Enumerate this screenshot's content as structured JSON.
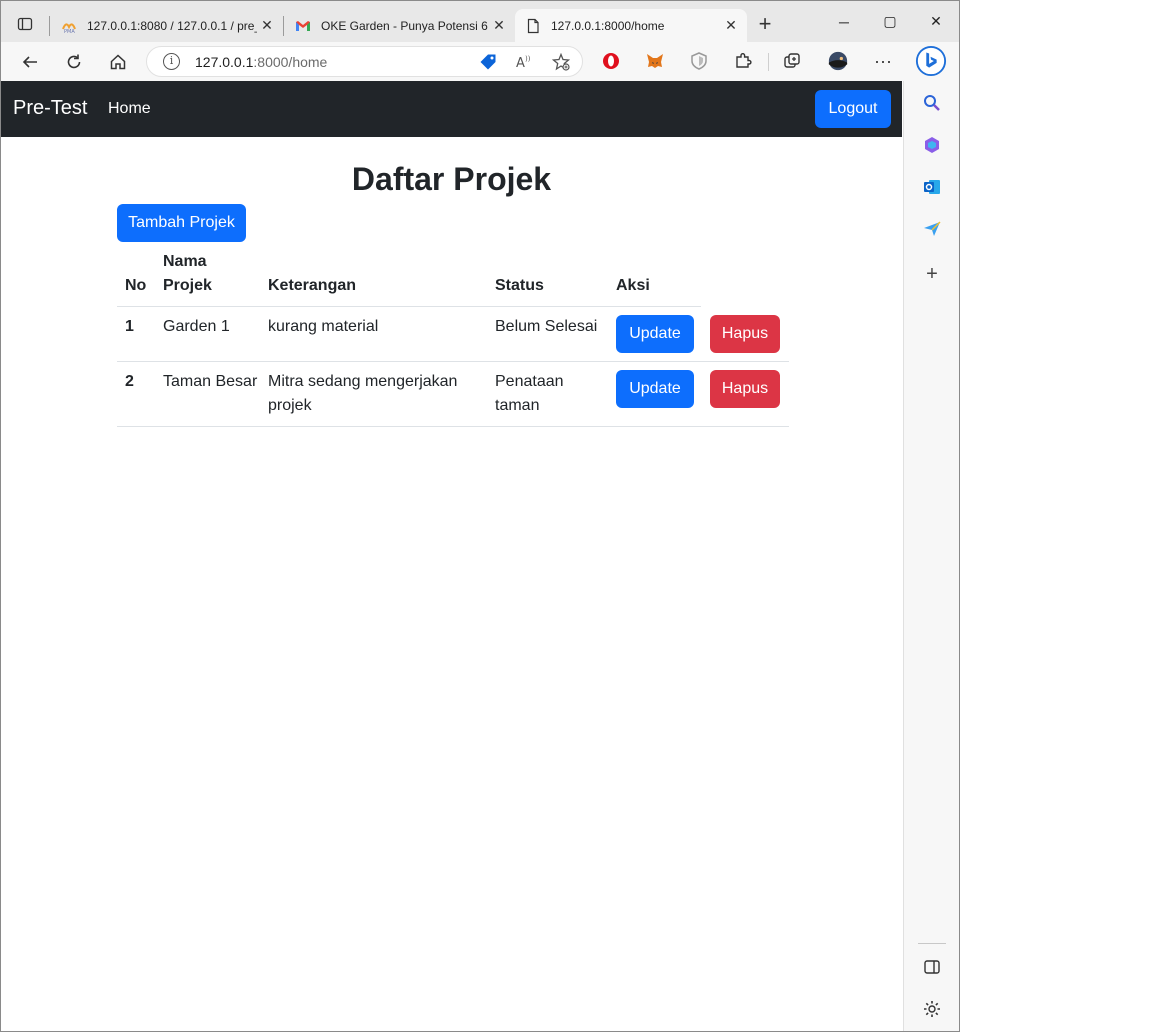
{
  "browser": {
    "tabs": [
      {
        "title": "127.0.0.1:8080 / 127.0.0.1 / pre_",
        "icon": "phpmyadmin-icon",
        "active": false
      },
      {
        "title": "OKE Garden - Punya Potensi 6 -",
        "icon": "gmail-icon",
        "active": false
      },
      {
        "title": "127.0.0.1:8000/home",
        "icon": "page-icon",
        "active": true
      }
    ],
    "new_tab_label": "+",
    "address": {
      "host": "127.0.0.1",
      "path": ":8000/home"
    },
    "window_controls": {
      "minimize": "─",
      "maximize": "▢",
      "close": "✕"
    }
  },
  "navbar": {
    "brand": "Pre-Test",
    "links": [
      "Home"
    ],
    "logout_label": "Logout",
    "bg_color": "#212529"
  },
  "page": {
    "title": "Daftar Projek",
    "add_button": "Tambah Projek",
    "table": {
      "headers": {
        "no": "No",
        "nama_line1": "Nama",
        "nama_line2": "Projek",
        "keterangan": "Keterangan",
        "status": "Status",
        "aksi": "Aksi"
      },
      "rows": [
        {
          "no": "1",
          "nama": "Garden 1",
          "keterangan": "kurang material",
          "keterangan2": "",
          "status": "Belum Selesai",
          "status2": "",
          "update": "Update",
          "hapus": "Hapus"
        },
        {
          "no": "2",
          "nama": "Taman Besar",
          "keterangan": "Mitra sedang mengerjakan",
          "keterangan2": "projek",
          "status": "Penataan",
          "status2": "taman",
          "update": "Update",
          "hapus": "Hapus"
        }
      ]
    }
  },
  "colors": {
    "primary": "#0d6efd",
    "danger": "#dc3545",
    "text": "#212529"
  }
}
